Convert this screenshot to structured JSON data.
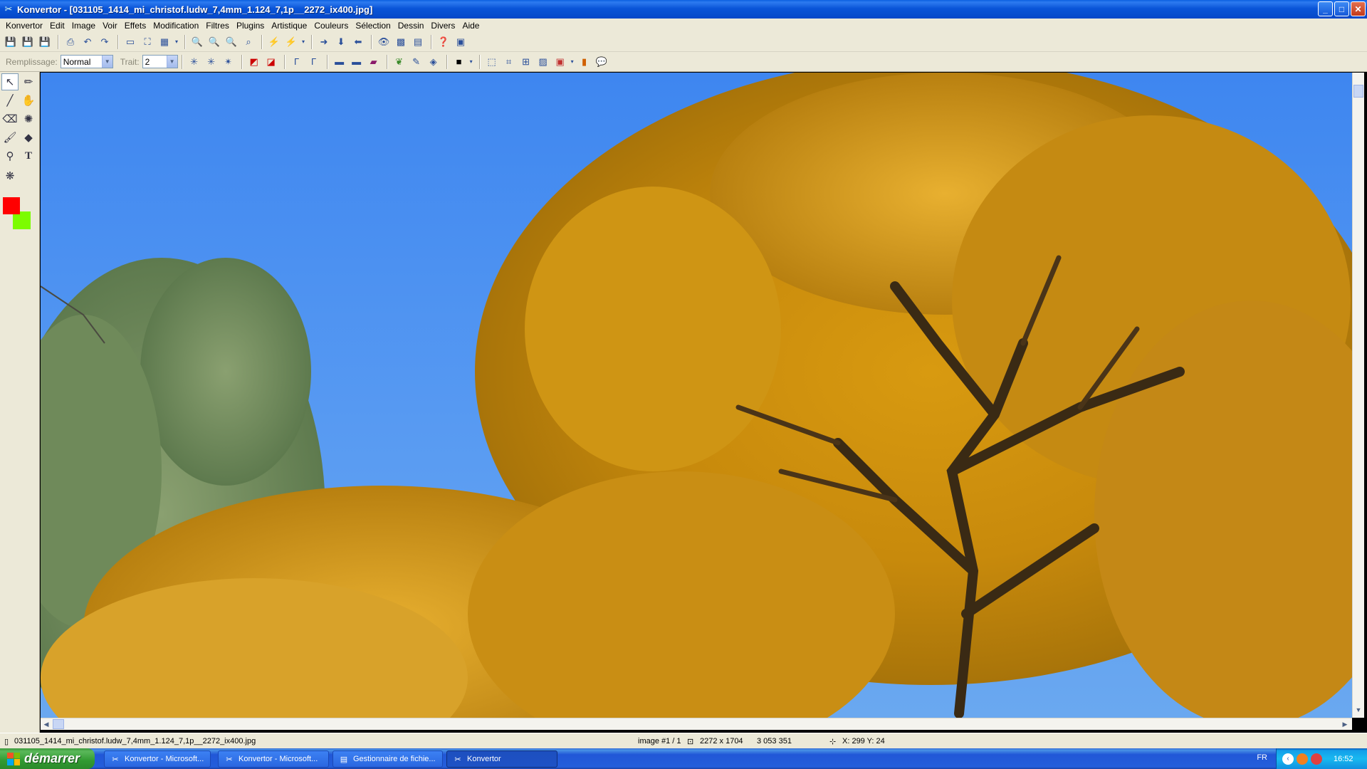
{
  "window": {
    "title": "Konvertor - [031105_1414_mi_christof.ludw_7,4mm_1.124_7,1p__2272_ix400.jpg]",
    "minimize": "_",
    "maximize": "□",
    "close": "✕"
  },
  "menu": [
    "Konvertor",
    "Edit",
    "Image",
    "Voir",
    "Effets",
    "Modification",
    "Filtres",
    "Plugins",
    "Artistique",
    "Couleurs",
    "Sélection",
    "Dessin",
    "Divers",
    "Aide"
  ],
  "toolbar2": {
    "fill_label": "Remplissage:",
    "fill_value": "Normal",
    "stroke_label": "Trait:",
    "stroke_value": "2"
  },
  "status": {
    "filename": "031105_1414_mi_christof.ludw_7,4mm_1.124_7,1p__2272_ix400.jpg",
    "image_index": "image #1 / 1",
    "dimensions": "2272 x 1704",
    "size": "3 053 351",
    "coords": "X: 299   Y: 24"
  },
  "taskbar": {
    "start_label": "démarrer",
    "tasks": [
      "Konvertor - Microsoft...",
      "Konvertor - Microsoft...",
      "Gestionnaire de fichie...",
      "Konvertor"
    ],
    "language": "FR",
    "clock": "16:52"
  },
  "colors": {
    "foreground": "#ff0000",
    "background": "#7cfc00",
    "sky": "#4a8ef0"
  }
}
